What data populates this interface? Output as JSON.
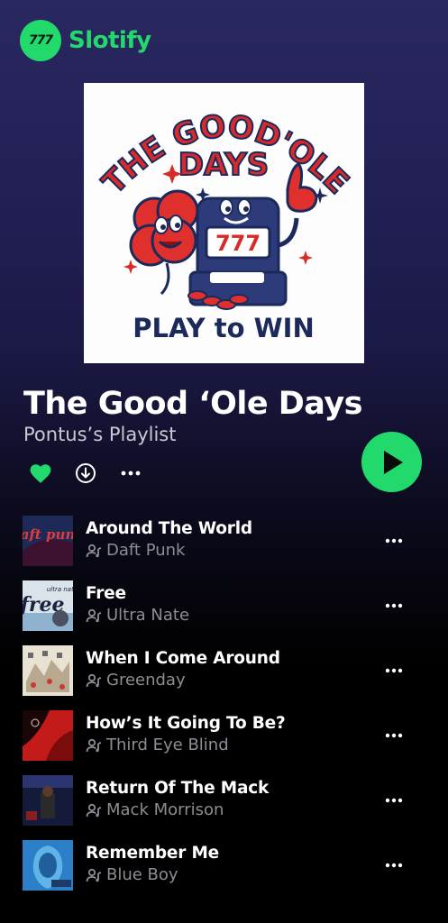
{
  "app": {
    "name": "Slotify",
    "logo_text": "777"
  },
  "cover": {
    "line1": "THE GOOD'OLE",
    "line2": "DAYS",
    "tagline": "PLAY to WIN",
    "reels": "777"
  },
  "playlist": {
    "title": "The Good ‘Ole Days",
    "owner": "Pontus’s Playlist"
  },
  "colors": {
    "accent": "#22d96c",
    "muted": "#8d8d94"
  },
  "actions": {
    "like_icon": "heart-icon",
    "download_icon": "download-icon",
    "more_icon": "more-icon",
    "play_icon": "play-icon"
  },
  "tracks": [
    {
      "title": "Around The World",
      "artist": "Daft Punk",
      "art_text": "daft punk"
    },
    {
      "title": "Free",
      "artist": "Ultra Nate",
      "art_text": "free",
      "art_text2": "ultra naté"
    },
    {
      "title": "When I Come Around",
      "artist": "Greenday",
      "art_text": ""
    },
    {
      "title": "How’s It Going To Be?",
      "artist": "Third Eye Blind",
      "art_text": ""
    },
    {
      "title": "Return Of The Mack",
      "artist": "Mack Morrison",
      "art_text": ""
    },
    {
      "title": "Remember Me",
      "artist": "Blue Boy",
      "art_text": ""
    }
  ]
}
